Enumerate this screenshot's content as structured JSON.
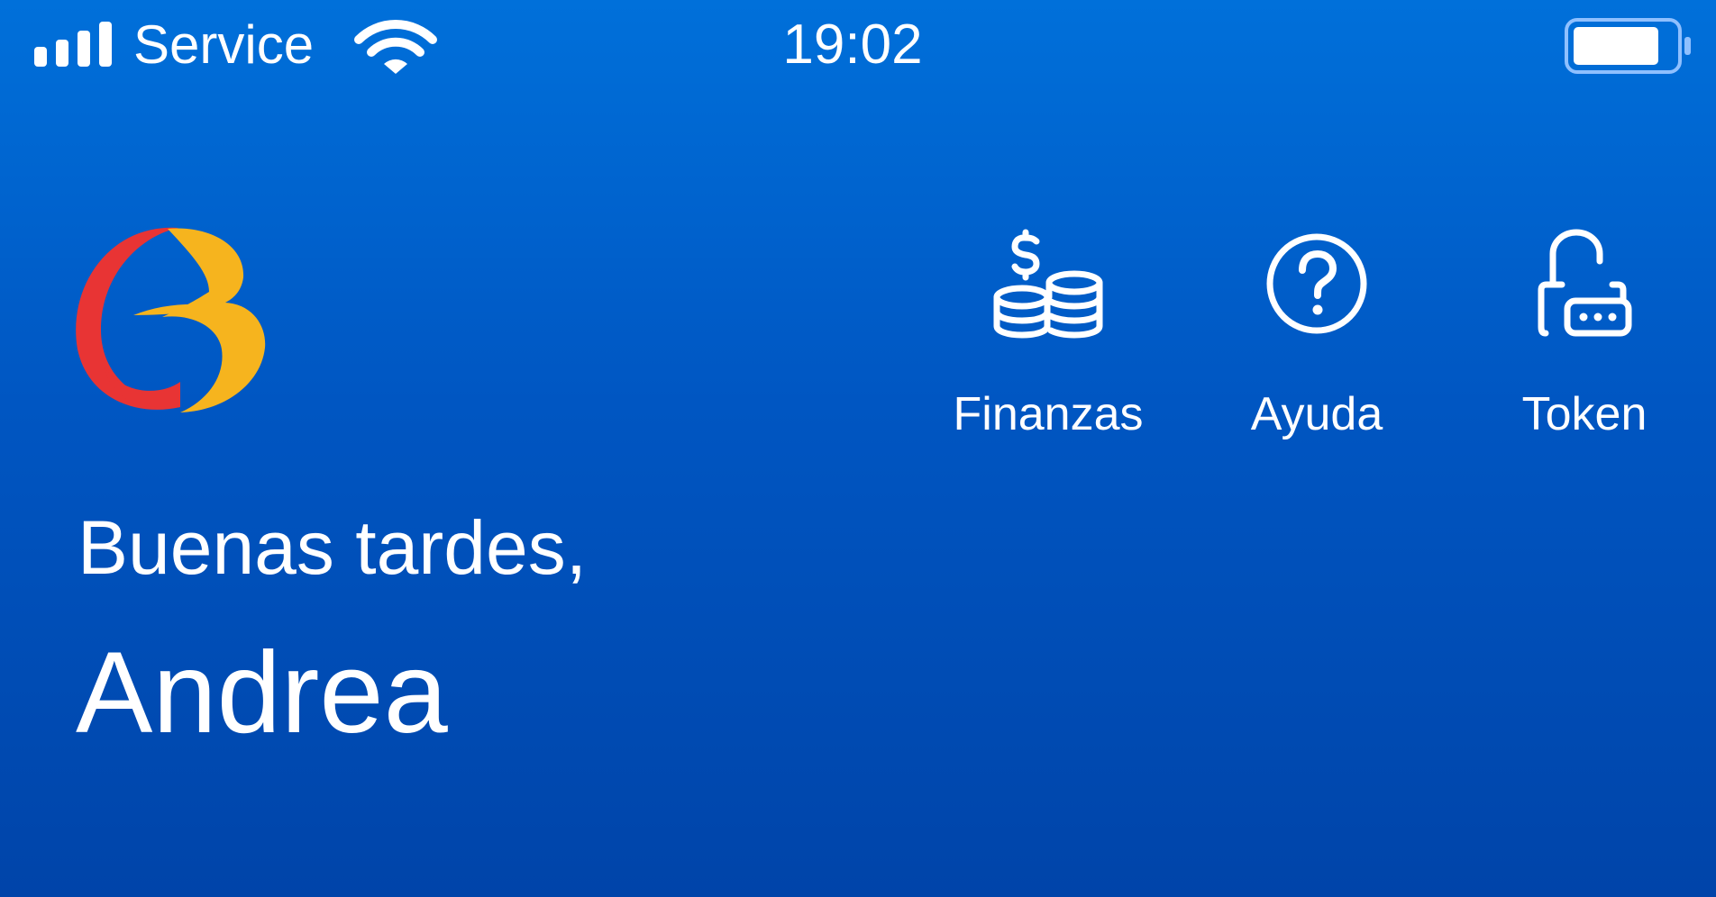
{
  "status_bar": {
    "carrier": "Service",
    "time": "19:02",
    "signal_icon": "cellular-signal-icon",
    "wifi_icon": "wifi-icon",
    "battery_icon": "battery-icon",
    "battery_level": 0.85
  },
  "brand": {
    "logo_icon": "bank-logo",
    "logo_colors": {
      "red": "#e83434",
      "yellow": "#f6b41e"
    }
  },
  "actions": [
    {
      "label": "Finanzas",
      "icon": "dollar-coins-icon"
    },
    {
      "label": "Ayuda",
      "icon": "help-circle-icon"
    },
    {
      "label": "Token",
      "icon": "unlocked-padlock-icon"
    }
  ],
  "home": {
    "greeting": "Buenas tardes,",
    "user_name": "Andrea"
  },
  "colors": {
    "background_top": "#0070da",
    "background_bottom": "#0044a9",
    "text": "#ffffff"
  }
}
